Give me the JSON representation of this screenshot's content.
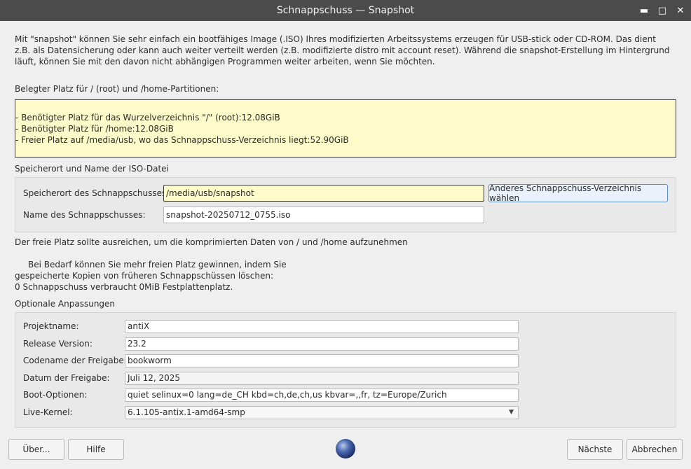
{
  "window": {
    "title": "Schnappschuss — Snapshot"
  },
  "intro": {
    "text": "Mit \"snapshot\" können Sie sehr einfach ein bootfähiges Image (.ISO) Ihres modifizierten Arbeitssystems erzeugen für USB-stick oder CD-ROM. Das dient z.B. als Datensicherung oder kann auch weiter verteilt werden (z.B. modifizierte distro mit account reset). Während die snapshot-Erstellung im Hintergrund läuft, können Sie mit den davon nicht abhängigen Programmen weiter arbeiten, wenn Sie möchten."
  },
  "space": {
    "heading": "Belegter Platz für / (root) und /home-Partitionen:",
    "lines": [
      "- Benötigter Platz für das Wurzelverzeichnis \"/\" (root):12.08GiB",
      "- Benötigter Platz für /home:12.08GiB",
      "- Freier Platz auf /media/usb, wo das Schnappschuss-Verzeichnis liegt:52.90GiB"
    ]
  },
  "location": {
    "heading": "Speicherort und Name der ISO-Datei",
    "dir_label": "Speicherort des Schnappschusses:",
    "dir_value": "/media/usb/snapshot",
    "choose_button": "Anderes Schnappschuss-Verzeichnis wählen",
    "name_label": "Name des Schnappschusses:",
    "name_value": "snapshot-20250712_0755.iso"
  },
  "info": {
    "free_space_note": "Der freie Platz sollte ausreichen, um die komprimierten Daten von / und /home aufzunehmen",
    "more_space_line1": "Bei Bedarf können Sie mehr freien Platz gewinnen, indem Sie",
    "more_space_line2": "gespeicherte Kopien von früheren Schnappschüssen löschen:",
    "snapshot_count": "0 Schnappschuss verbraucht 0MiB Festplattenplatz."
  },
  "options": {
    "heading": "Optionale Anpassungen",
    "project_label": "Projektname:",
    "project_value": "antiX",
    "release_label": "Release Version:",
    "release_value": "23.2",
    "codename_label": "Codename der Freigabe:",
    "codename_value": "bookworm",
    "date_label": "Datum der Freigabe:",
    "date_value": "Juli 12, 2025",
    "boot_label": "Boot-Optionen:",
    "boot_value": "quiet selinux=0 lang=de_CH kbd=ch,de,ch,us kbvar=,,fr, tz=Europe/Zurich",
    "kernel_label": "Live-Kernel:",
    "kernel_value": "6.1.105-antix.1-amd64-smp"
  },
  "buttons": {
    "about": "Über...",
    "help": "Hilfe",
    "next": "Nächste",
    "cancel": "Abbrechen"
  }
}
